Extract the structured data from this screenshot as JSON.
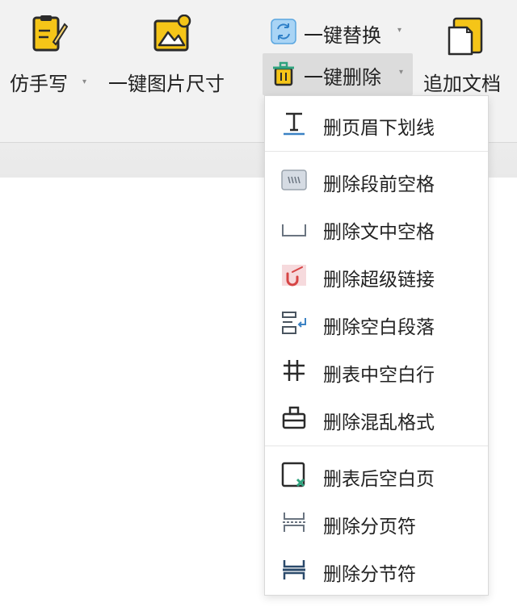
{
  "ribbon": {
    "tools": [
      {
        "id": "fangshouxie",
        "label": "仿手写",
        "has_dropdown": true,
        "icon": "handwriting-doc-icon"
      },
      {
        "id": "resize",
        "label": "一键图片尺寸",
        "has_dropdown": false,
        "icon": "image-resize-icon"
      },
      {
        "id": "replace",
        "label": "一键替换",
        "has_dropdown": true,
        "icon": "replace-icon"
      },
      {
        "id": "delete",
        "label": "一键删除",
        "has_dropdown": true,
        "icon": "trash-icon",
        "active": true
      },
      {
        "id": "append",
        "label": "追加文档",
        "has_dropdown": false,
        "icon": "append-doc-icon"
      }
    ],
    "caret_glyph": "▾"
  },
  "menu": {
    "items": [
      {
        "label": "删页眉下划线",
        "icon": "header-underline-icon"
      },
      {
        "label": "删除段前空格",
        "icon": "paragraph-space-icon"
      },
      {
        "label": "删除文中空格",
        "icon": "inline-space-icon"
      },
      {
        "label": "删除超级链接",
        "icon": "hyperlink-icon"
      },
      {
        "label": "删除空白段落",
        "icon": "blank-paragraph-icon"
      },
      {
        "label": "删表中空白行",
        "icon": "table-grid-icon"
      },
      {
        "label": "删除混乱格式",
        "icon": "clear-format-icon"
      },
      {
        "label": "删表后空白页",
        "icon": "blank-page-icon"
      },
      {
        "label": "删除分页符",
        "icon": "page-break-icon"
      },
      {
        "label": "删除分节符",
        "icon": "section-break-icon"
      }
    ]
  },
  "colors": {
    "accent_yellow": "#f5c518",
    "accent_teal": "#2fa37e",
    "accent_blue": "#3b82c4",
    "accent_red": "#d64545"
  }
}
